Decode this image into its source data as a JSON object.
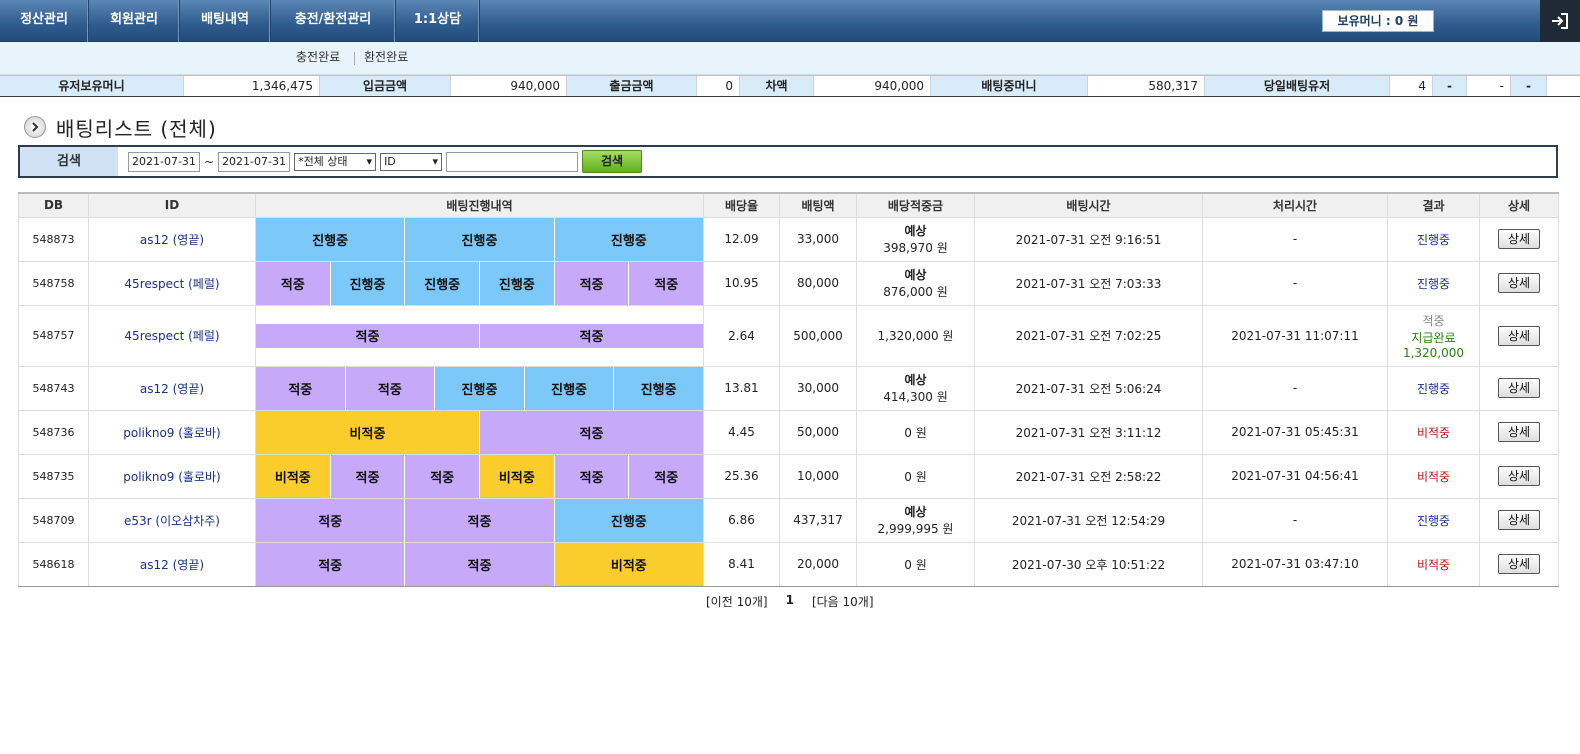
{
  "nav": {
    "items": [
      "정산관리",
      "회원관리",
      "배팅내역",
      "충전/환전관리",
      "1:1상담"
    ],
    "money_label": "보유머니 : 0 원"
  },
  "subnav": {
    "items": [
      "충전완료",
      "환전완료"
    ]
  },
  "summary": [
    {
      "label": "유저보유머니",
      "value": "1,346,475"
    },
    {
      "label": "입금금액",
      "value": "940,000"
    },
    {
      "label": "출금금액",
      "value": "0"
    },
    {
      "label": "차액",
      "value": "940,000"
    },
    {
      "label": "배팅중머니",
      "value": "580,317"
    },
    {
      "label": "당일배팅유저",
      "value": "4"
    },
    {
      "label": "",
      "value": "-"
    },
    {
      "label": "",
      "value": "-"
    },
    {
      "label": "",
      "value": "-"
    }
  ],
  "title": "배팅리스트 (전체)",
  "search": {
    "label": "검색",
    "date_from": "2021-07-31",
    "tilde": "~",
    "date_to": "2021-07-31",
    "status_select": "*전체 상태",
    "field_select": "ID",
    "keyword": "",
    "button": "검색"
  },
  "table": {
    "headers": [
      "DB",
      "ID",
      "배팅진행내역",
      "배당율",
      "배팅액",
      "배당적중금",
      "배팅시간",
      "처리시간",
      "결과",
      "상세"
    ],
    "detail_label": "상세",
    "rows": [
      {
        "db": "548873",
        "id": "as12 (영끝)",
        "legs": [
          {
            "t": "진행중",
            "s": "ing"
          },
          {
            "t": "진행중",
            "s": "ing"
          },
          {
            "t": "진행중",
            "s": "ing"
          }
        ],
        "odds": "12.09",
        "amount": "33,000",
        "win_label": "예상",
        "win": "398,970 원",
        "bet_time": "2021-07-31 오전 9:16:51",
        "proc_time": "-",
        "result": "진행중",
        "result_type": "ing"
      },
      {
        "db": "548758",
        "id": "45respect (페럴)",
        "legs": [
          {
            "t": "적중",
            "s": "hit"
          },
          {
            "t": "진행중",
            "s": "ing"
          },
          {
            "t": "진행중",
            "s": "ing"
          },
          {
            "t": "진행중",
            "s": "ing"
          },
          {
            "t": "적중",
            "s": "hit"
          },
          {
            "t": "적중",
            "s": "hit"
          }
        ],
        "odds": "10.95",
        "amount": "80,000",
        "win_label": "예상",
        "win": "876,000 원",
        "bet_time": "2021-07-31 오전 7:03:33",
        "proc_time": "-",
        "result": "진행중",
        "result_type": "ing"
      },
      {
        "db": "548757",
        "id": "45respect (페럴)",
        "legs": [
          {
            "t": "적중",
            "s": "hit"
          },
          {
            "t": "적중",
            "s": "hit"
          }
        ],
        "odds": "2.64",
        "amount": "500,000",
        "win_label": "",
        "win": "1,320,000 원",
        "bet_time": "2021-07-31 오전 7:02:25",
        "proc_time": "2021-07-31 11:07:11",
        "result": "적중",
        "result2": "지급완료",
        "result3": "1,320,000",
        "result_type": "paid"
      },
      {
        "db": "548743",
        "id": "as12 (영끝)",
        "legs": [
          {
            "t": "적중",
            "s": "hit"
          },
          {
            "t": "적중",
            "s": "hit"
          },
          {
            "t": "진행중",
            "s": "ing"
          },
          {
            "t": "진행중",
            "s": "ing"
          },
          {
            "t": "진행중",
            "s": "ing"
          }
        ],
        "odds": "13.81",
        "amount": "30,000",
        "win_label": "예상",
        "win": "414,300 원",
        "bet_time": "2021-07-31 오전 5:06:24",
        "proc_time": "-",
        "result": "진행중",
        "result_type": "ing"
      },
      {
        "db": "548736",
        "id": "polikno9 (홀로바)",
        "legs": [
          {
            "t": "비적중",
            "s": "miss"
          },
          {
            "t": "적중",
            "s": "hit"
          }
        ],
        "odds": "4.45",
        "amount": "50,000",
        "win_label": "",
        "win": "0 원",
        "bet_time": "2021-07-31 오전 3:11:12",
        "proc_time": "2021-07-31 05:45:31",
        "result": "비적중",
        "result_type": "miss"
      },
      {
        "db": "548735",
        "id": "polikno9 (홀로바)",
        "legs": [
          {
            "t": "비적중",
            "s": "miss"
          },
          {
            "t": "적중",
            "s": "hit"
          },
          {
            "t": "적중",
            "s": "hit"
          },
          {
            "t": "비적중",
            "s": "miss"
          },
          {
            "t": "적중",
            "s": "hit"
          },
          {
            "t": "적중",
            "s": "hit"
          }
        ],
        "odds": "25.36",
        "amount": "10,000",
        "win_label": "",
        "win": "0 원",
        "bet_time": "2021-07-31 오전 2:58:22",
        "proc_time": "2021-07-31 04:56:41",
        "result": "비적중",
        "result_type": "miss"
      },
      {
        "db": "548709",
        "id": "e53r (이오삼차주)",
        "legs": [
          {
            "t": "적중",
            "s": "hit"
          },
          {
            "t": "적중",
            "s": "hit"
          },
          {
            "t": "진행중",
            "s": "ing"
          }
        ],
        "odds": "6.86",
        "amount": "437,317",
        "win_label": "예상",
        "win": "2,999,995 원",
        "bet_time": "2021-07-31 오전 12:54:29",
        "proc_time": "-",
        "result": "진행중",
        "result_type": "ing"
      },
      {
        "db": "548618",
        "id": "as12 (영끝)",
        "legs": [
          {
            "t": "적중",
            "s": "hit"
          },
          {
            "t": "적중",
            "s": "hit"
          },
          {
            "t": "비적중",
            "s": "miss"
          }
        ],
        "odds": "8.41",
        "amount": "20,000",
        "win_label": "",
        "win": "0 원",
        "bet_time": "2021-07-30 오후 10:51:22",
        "proc_time": "2021-07-31 03:47:10",
        "result": "비적중",
        "result_type": "miss"
      }
    ]
  },
  "pager": {
    "prev": "[이전 10개]",
    "current": "1",
    "next": "[다음 10개]"
  }
}
